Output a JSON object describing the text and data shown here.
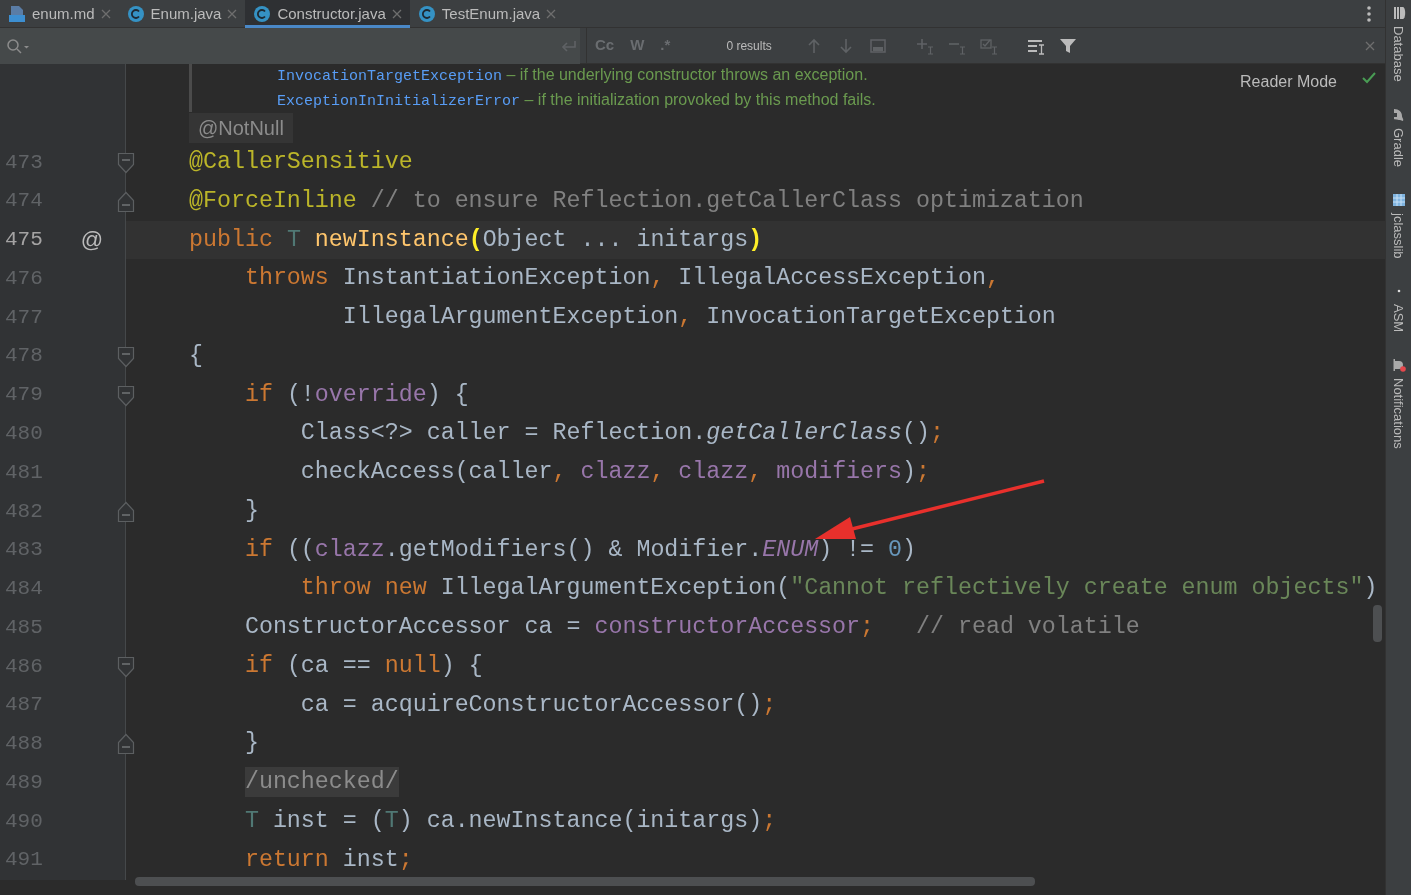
{
  "tabs": [
    {
      "label": "enum.md",
      "kind": "markdown",
      "selected": false
    },
    {
      "label": "Enum.java",
      "kind": "class",
      "selected": false
    },
    {
      "label": "Constructor.java",
      "kind": "class",
      "selected": true
    },
    {
      "label": "TestEnum.java",
      "kind": "class",
      "selected": false
    }
  ],
  "find_bar": {
    "toggles": [
      {
        "label": "Cc",
        "selected": false
      },
      {
        "label": "W",
        "selected": false
      },
      {
        "label": ".*",
        "selected": false
      }
    ],
    "results": "0 results"
  },
  "doc": {
    "lines": [
      {
        "link": "InvocationTargetException",
        "text": " – if the underlying constructor throws an exception."
      },
      {
        "link": "ExceptionInInitializerError",
        "text": " – if the initialization provoked by this method fails."
      }
    ],
    "reader_mode": "Reader Mode"
  },
  "inlay": "@NotNull",
  "lines": [
    {
      "number": "473",
      "fold_start": true,
      "fold_end": false,
      "current": false,
      "tokens": [
        {
          "kind": "annotation",
          "text": "@CallerSensitive"
        }
      ]
    },
    {
      "number": "474",
      "fold_start": false,
      "fold_end": true,
      "current": false,
      "tokens": [
        {
          "kind": "annotation",
          "text": "@ForceInline"
        },
        {
          "kind": "comment",
          "text": " // to ensure Reflection.getCallerClass optimization"
        }
      ]
    },
    {
      "number": "475",
      "marker": "@",
      "fold_start": false,
      "fold_end": false,
      "current": true,
      "tokens": [
        {
          "kind": "keyword",
          "text": "public "
        },
        {
          "kind": "typeparam",
          "text": "T"
        },
        {
          "kind": "method",
          "text": " newInstance"
        },
        {
          "kind": "brace",
          "text": "("
        },
        {
          "kind": "plain",
          "text": "Object ... initargs"
        },
        {
          "kind": "brace",
          "text": ")"
        }
      ]
    },
    {
      "number": "476",
      "fold_start": false,
      "fold_end": false,
      "current": false,
      "tokens": [
        {
          "kind": "keyword",
          "text": "    throws "
        },
        {
          "kind": "plain",
          "text": "InstantiationException"
        },
        {
          "kind": "keyword",
          "text": ", "
        },
        {
          "kind": "plain",
          "text": "IllegalAccessException"
        },
        {
          "kind": "keyword",
          "text": ","
        }
      ]
    },
    {
      "number": "477",
      "fold_start": false,
      "fold_end": false,
      "current": false,
      "tokens": [
        {
          "kind": "plain",
          "text": "           IllegalArgumentException"
        },
        {
          "kind": "keyword",
          "text": ", "
        },
        {
          "kind": "plain",
          "text": "InvocationTargetException"
        }
      ]
    },
    {
      "number": "478",
      "fold_start": true,
      "fold_end": false,
      "current": false,
      "tokens": [
        {
          "kind": "plain",
          "text": "{"
        }
      ]
    },
    {
      "number": "479",
      "fold_start": true,
      "fold_end": false,
      "current": false,
      "tokens": [
        {
          "kind": "keyword",
          "text": "    if "
        },
        {
          "kind": "plain",
          "text": "(!"
        },
        {
          "kind": "field",
          "text": "override"
        },
        {
          "kind": "plain",
          "text": ") {"
        }
      ]
    },
    {
      "number": "480",
      "fold_start": false,
      "fold_end": false,
      "current": false,
      "tokens": [
        {
          "kind": "plain",
          "text": "        Class<?> caller = Reflection."
        },
        {
          "kind": "italic",
          "text": "getCallerClass"
        },
        {
          "kind": "plain",
          "text": "()"
        },
        {
          "kind": "keyword",
          "text": ";"
        }
      ]
    },
    {
      "number": "481",
      "fold_start": false,
      "fold_end": false,
      "current": false,
      "tokens": [
        {
          "kind": "plain",
          "text": "        checkAccess(caller"
        },
        {
          "kind": "keyword",
          "text": ", "
        },
        {
          "kind": "field",
          "text": "clazz"
        },
        {
          "kind": "keyword",
          "text": ", "
        },
        {
          "kind": "field",
          "text": "clazz"
        },
        {
          "kind": "keyword",
          "text": ", "
        },
        {
          "kind": "field",
          "text": "modifiers"
        },
        {
          "kind": "plain",
          "text": ")"
        },
        {
          "kind": "keyword",
          "text": ";"
        }
      ]
    },
    {
      "number": "482",
      "fold_start": false,
      "fold_end": true,
      "current": false,
      "tokens": [
        {
          "kind": "plain",
          "text": "    }"
        }
      ]
    },
    {
      "number": "483",
      "fold_start": false,
      "fold_end": false,
      "current": false,
      "tokens": [
        {
          "kind": "keyword",
          "text": "    if "
        },
        {
          "kind": "plain",
          "text": "(("
        },
        {
          "kind": "field",
          "text": "clazz"
        },
        {
          "kind": "plain",
          "text": ".getModifiers() & Modifier."
        },
        {
          "kind": "static",
          "text": "ENUM"
        },
        {
          "kind": "plain",
          "text": ") != "
        },
        {
          "kind": "number",
          "text": "0"
        },
        {
          "kind": "plain",
          "text": ")"
        }
      ]
    },
    {
      "number": "484",
      "fold_start": false,
      "fold_end": false,
      "current": false,
      "tokens": [
        {
          "kind": "keyword",
          "text": "        throw new "
        },
        {
          "kind": "plain",
          "text": "IllegalArgumentException("
        },
        {
          "kind": "string",
          "text": "\"Cannot reflectively create enum objects\""
        },
        {
          "kind": "plain",
          "text": ")"
        }
      ]
    },
    {
      "number": "485",
      "fold_start": false,
      "fold_end": false,
      "current": false,
      "tokens": [
        {
          "kind": "plain",
          "text": "    ConstructorAccessor ca = "
        },
        {
          "kind": "field",
          "text": "constructorAccessor"
        },
        {
          "kind": "keyword",
          "text": ";"
        },
        {
          "kind": "comment",
          "text": "   // read volatile"
        }
      ]
    },
    {
      "number": "486",
      "fold_start": true,
      "fold_end": false,
      "current": false,
      "tokens": [
        {
          "kind": "keyword",
          "text": "    if "
        },
        {
          "kind": "plain",
          "text": "(ca == "
        },
        {
          "kind": "keyword",
          "text": "null"
        },
        {
          "kind": "plain",
          "text": ") {"
        }
      ]
    },
    {
      "number": "487",
      "fold_start": false,
      "fold_end": false,
      "current": false,
      "tokens": [
        {
          "kind": "plain",
          "text": "        ca = acquireConstructorAccessor()"
        },
        {
          "kind": "keyword",
          "text": ";"
        }
      ]
    },
    {
      "number": "488",
      "fold_start": false,
      "fold_end": true,
      "current": false,
      "tokens": [
        {
          "kind": "plain",
          "text": "    }"
        }
      ]
    },
    {
      "number": "489",
      "fold_start": false,
      "fold_end": false,
      "current": false,
      "tokens": [
        {
          "kind": "folded",
          "text": "    /unchecked/"
        }
      ]
    },
    {
      "number": "490",
      "fold_start": false,
      "fold_end": false,
      "current": false,
      "tokens": [
        {
          "kind": "typeparam",
          "text": "    T"
        },
        {
          "kind": "plain",
          "text": " inst = ("
        },
        {
          "kind": "typeparam",
          "text": "T"
        },
        {
          "kind": "plain",
          "text": ") ca.newInstance(initargs)"
        },
        {
          "kind": "keyword",
          "text": ";"
        }
      ]
    },
    {
      "number": "491",
      "fold_start": false,
      "fold_end": false,
      "current": false,
      "tokens": [
        {
          "kind": "keyword",
          "text": "    return "
        },
        {
          "kind": "plain",
          "text": "inst"
        },
        {
          "kind": "keyword",
          "text": ";"
        }
      ]
    }
  ],
  "sidebar": [
    {
      "label": "Database",
      "kind": "database"
    },
    {
      "label": "Gradle",
      "kind": "elephant"
    },
    {
      "label": "jclasslib",
      "kind": "grid"
    },
    {
      "label": "ASM",
      "kind": "dot"
    },
    {
      "label": "Notifications",
      "kind": "bell"
    }
  ]
}
